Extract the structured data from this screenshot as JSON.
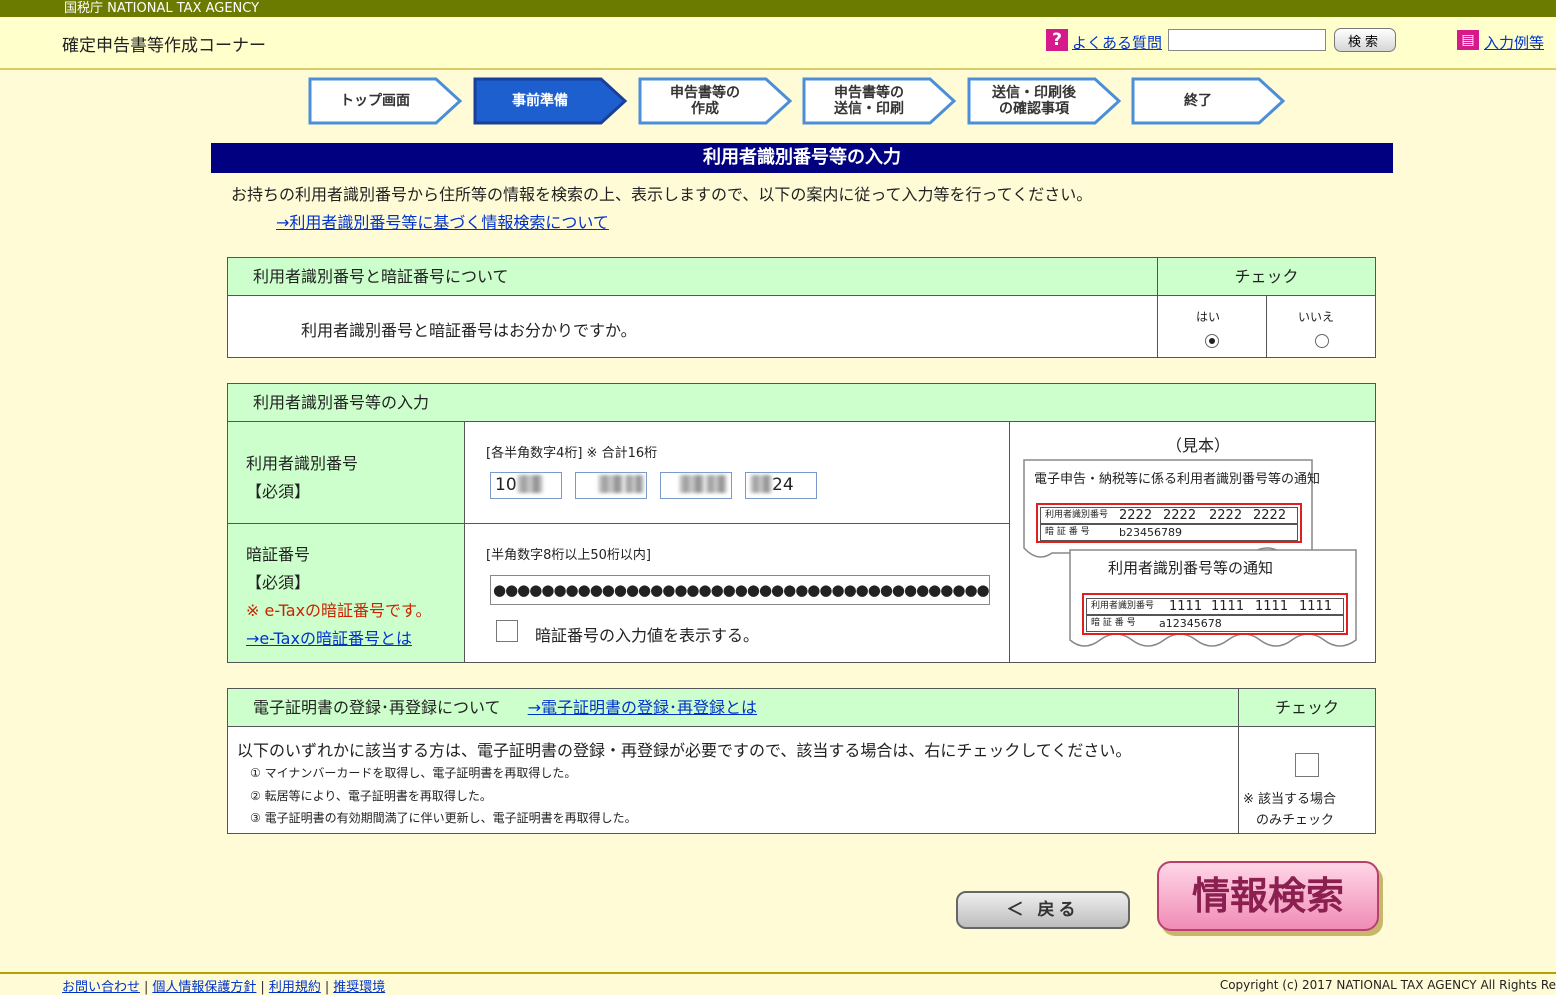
{
  "agency": "国税庁  NATIONAL TAX AGENCY",
  "header": {
    "title": "確定申告書等作成コーナー",
    "faq_link": "よくある質問",
    "search_button": "検索",
    "example_link": "入力例等"
  },
  "steps": [
    {
      "label": "トップ画面",
      "active": false
    },
    {
      "label": "事前準備",
      "active": true
    },
    {
      "label": "申告書等の\n作成",
      "active": false
    },
    {
      "label": "申告書等の\n送信・印刷",
      "active": false
    },
    {
      "label": "送信・印刷後\nの確認事項",
      "active": false
    },
    {
      "label": "終了",
      "active": false
    }
  ],
  "banner": "利用者識別番号等の入力",
  "intro": "お持ちの利用者識別番号から住所等の情報を検索の上、表示しますので、以下の案内に従って入力等を行ってください。",
  "intro_link": "→利用者識別番号等に基づく情報検索について",
  "section1": {
    "header": "利用者識別番号と暗証番号について",
    "check_header": "チェック",
    "question": "利用者識別番号と暗証番号はお分かりですか。",
    "yes": "はい",
    "no": "いいえ",
    "selected": "yes"
  },
  "section2": {
    "header": "利用者識別番号等の入力",
    "id_label": "利用者識別番号",
    "required": "【必須】",
    "id_hint": "[各半角数字4桁]  ※ 合計16桁",
    "id_parts": [
      "10",
      "",
      "",
      "24"
    ],
    "pw_label": "暗証番号",
    "pw_note": "※ e-Taxの暗証番号です。",
    "pw_link": "→e-Taxの暗証番号とは",
    "pw_hint": "[半角数字8桁以上50桁以内]",
    "pw_value": "●●●●●●●●●●●●●●●●●●●●●●●●●●●●●●●●●●●●●●●●●●",
    "show_pw_label": "暗証番号の入力値を表示する。",
    "sample": {
      "title": "（見本）",
      "back_title": "電子申告・納税等に係る利用者識別番号等の通知",
      "back_id_label": "利用者識別番号",
      "back_id": [
        "2222",
        "2222",
        "2222",
        "2222"
      ],
      "back_pw_label": "暗 証 番 号",
      "back_pw": "b23456789",
      "front_title": "利用者識別番号等の通知",
      "front_id_label": "利用者識別番号",
      "front_id": [
        "1111",
        "1111",
        "1111",
        "1111"
      ],
      "front_pw_label": "暗 証 番 号",
      "front_pw": "a12345678"
    }
  },
  "section3": {
    "header": "電子証明書の登録･再登録について",
    "header_link": "→電子証明書の登録･再登録とは",
    "check_header": "チェック",
    "intro": "以下のいずれかに該当する方は、電子証明書の登録・再登録が必要ですので、該当する場合は、右にチェックしてください。",
    "items": [
      "① マイナンバーカードを取得し、電子証明書を再取得した。",
      "② 転居等により、電子証明書を再取得した。",
      "③ 電子証明書の有効期間満了に伴い更新し、電子証明書を再取得した。"
    ],
    "check_note1": "※  該当する場合",
    "check_note2": "のみチェック"
  },
  "buttons": {
    "back": "＜ 戻る",
    "search": "情報検索"
  },
  "footer": {
    "links": [
      "お問い合わせ",
      "個人情報保護方針",
      "利用規約",
      "推奨環境"
    ],
    "copyright": "Copyright (c) 2017 NATIONAL TAX AGENCY All Rights Re"
  }
}
